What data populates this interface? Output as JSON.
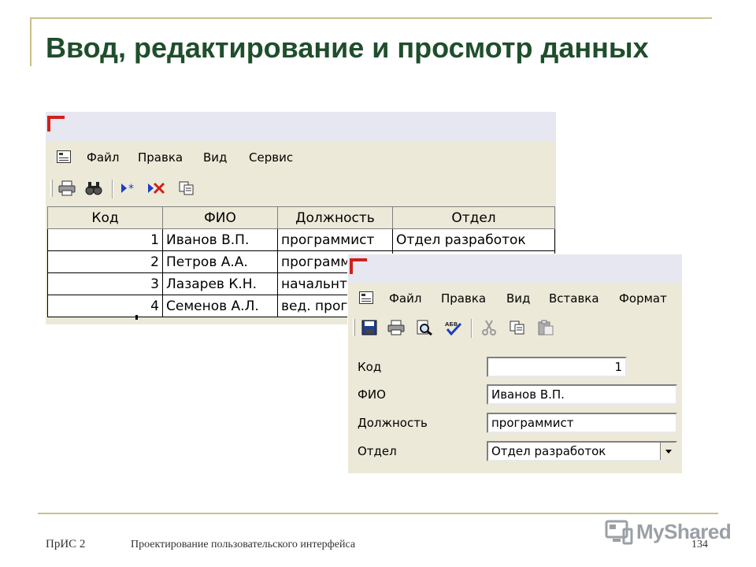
{
  "slide": {
    "title": "Ввод, редактирование и просмотр данных",
    "footer_left": "ПрИС 2",
    "footer_center": "Проектирование пользовательского интерфейса",
    "page_number": "134",
    "logo_text": "MyShared"
  },
  "table_window": {
    "menu": [
      "Файл",
      "Правка",
      "Вид",
      "Сервис"
    ],
    "toolbar_icons": [
      "print-icon",
      "find-icon",
      "new-record-icon",
      "delete-record-icon",
      "copy-icon"
    ],
    "columns": [
      "Код",
      "ФИО",
      "Должность",
      "Отдел"
    ],
    "rows": [
      {
        "code": "1",
        "name": "Иванов В.П.",
        "position": "программист",
        "dept": "Отдел разработок"
      },
      {
        "code": "2",
        "name": "Петров А.А.",
        "position": "программ",
        "dept": ""
      },
      {
        "code": "3",
        "name": "Лазарев К.Н.",
        "position": "начальнт",
        "dept": ""
      },
      {
        "code": "4",
        "name": "Семенов А.Л.",
        "position": "вед. прог",
        "dept": ""
      }
    ]
  },
  "form_window": {
    "menu": [
      "Файл",
      "Правка",
      "Вид",
      "Вставка",
      "Формат"
    ],
    "toolbar_icons": [
      "save-icon",
      "print-icon",
      "preview-icon",
      "spellcheck-icon",
      "cut-icon",
      "copy-icon",
      "paste-icon"
    ],
    "fields": [
      {
        "label": "Код",
        "value": "1"
      },
      {
        "label": "ФИО",
        "value": "Иванов В.П."
      },
      {
        "label": "Должность",
        "value": "программист"
      },
      {
        "label": "Отдел",
        "value": "Отдел разработок"
      }
    ]
  },
  "colors": {
    "title": "#1f4e2c",
    "accent_line": "#c9c08a",
    "window_bg": "#ece9d8",
    "title_icon": "#d0201a"
  }
}
